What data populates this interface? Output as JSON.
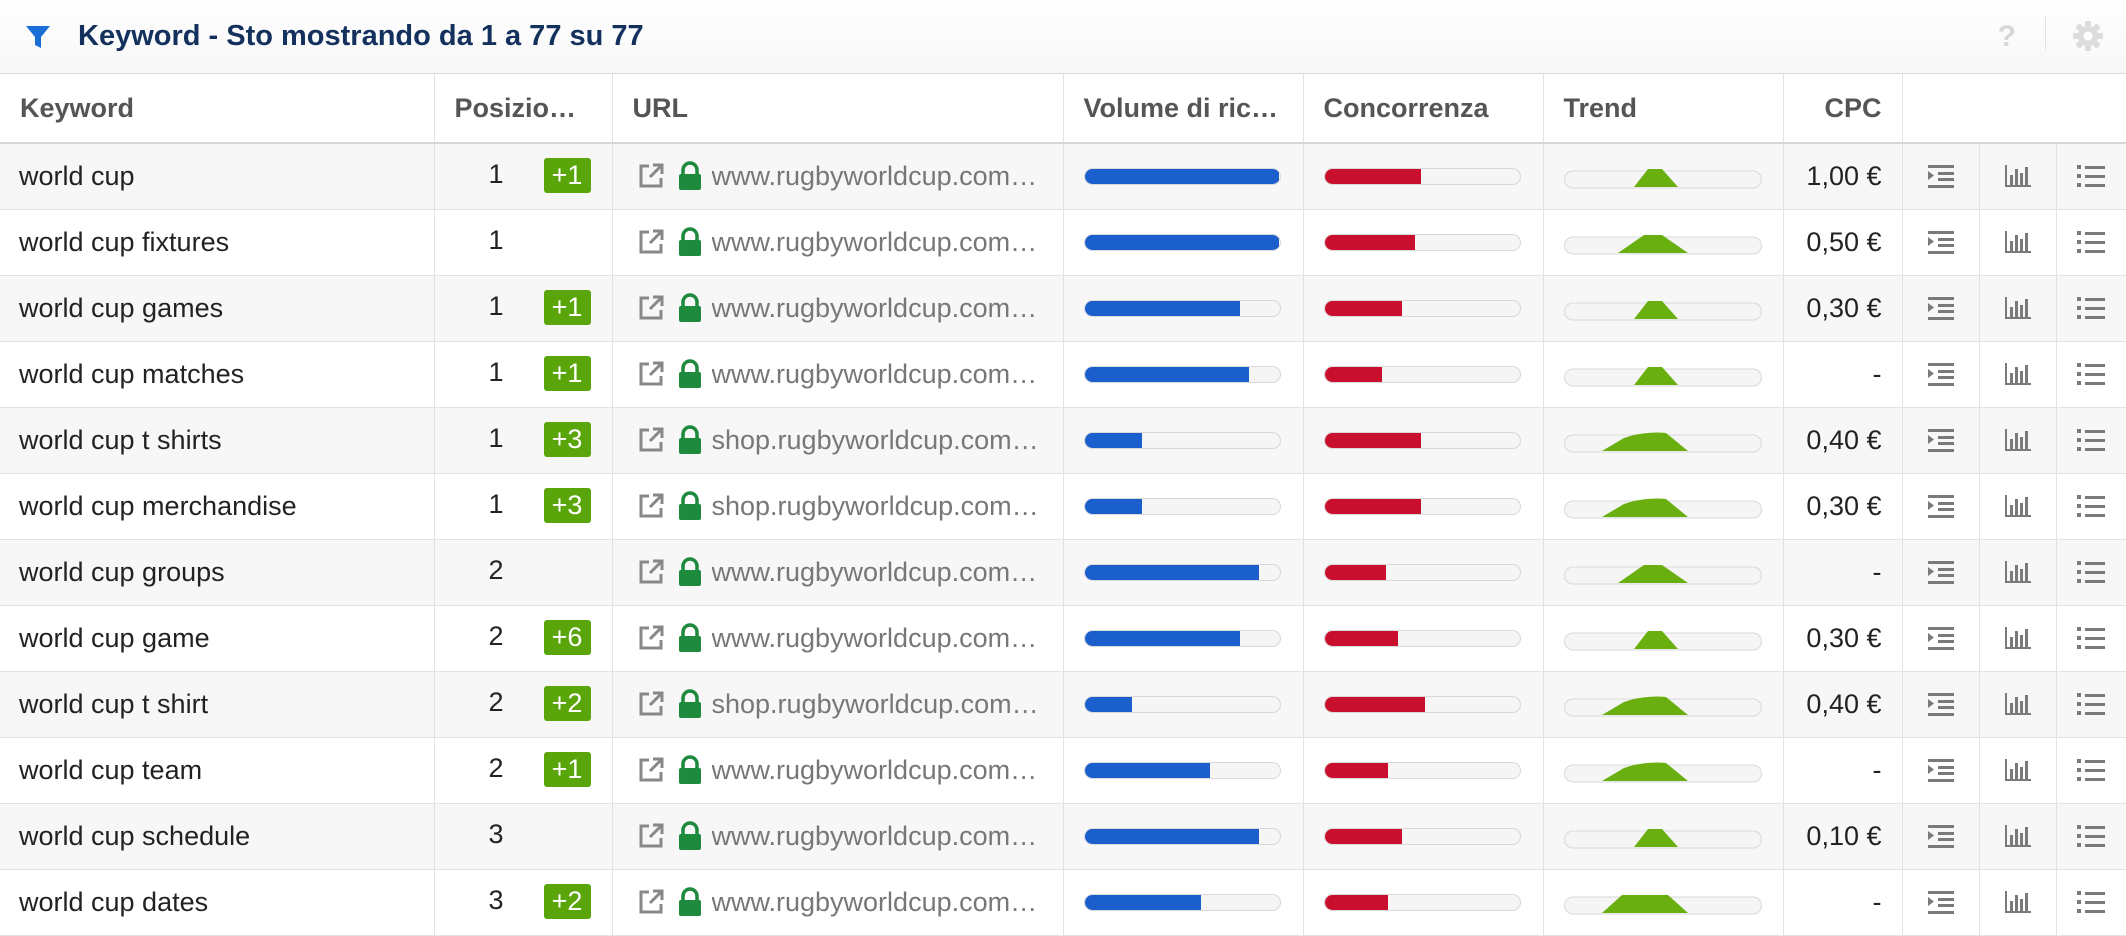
{
  "header": {
    "title": "Keyword - Sto mostrando da 1 a 77 su 77",
    "help_label": "?"
  },
  "columns": {
    "keyword": "Keyword",
    "position": "Posizion…",
    "url": "URL",
    "volume": "Volume di ric…",
    "competition": "Concorrenza",
    "trend": "Trend",
    "cpc": "CPC"
  },
  "colors": {
    "badge": "#5aa50a",
    "volume_bar": "#1a5fcc",
    "competition_bar": "#c8102e",
    "trend": "#6aaf10",
    "lock": "#1e8a3e",
    "title": "#13315c"
  },
  "rows": [
    {
      "keyword": "world cup",
      "position": "1",
      "change": "+1",
      "url": "www.rugbyworldcup.com…",
      "volume": 1.0,
      "competition": 0.5,
      "trend": "narrow",
      "cpc": "1,00 €"
    },
    {
      "keyword": "world cup fixtures",
      "position": "1",
      "change": "",
      "url": "www.rugbyworldcup.com…",
      "volume": 1.0,
      "competition": 0.47,
      "trend": "medium",
      "cpc": "0,50 €"
    },
    {
      "keyword": "world cup games",
      "position": "1",
      "change": "+1",
      "url": "www.rugbyworldcup.com…",
      "volume": 0.8,
      "competition": 0.4,
      "trend": "narrow",
      "cpc": "0,30 €"
    },
    {
      "keyword": "world cup matches",
      "position": "1",
      "change": "+1",
      "url": "www.rugbyworldcup.com…",
      "volume": 0.85,
      "competition": 0.3,
      "trend": "narrow",
      "cpc": "-"
    },
    {
      "keyword": "world cup t shirts",
      "position": "1",
      "change": "+3",
      "url": "shop.rugbyworldcup.com…",
      "volume": 0.3,
      "competition": 0.5,
      "trend": "wide",
      "cpc": "0,40 €"
    },
    {
      "keyword": "world cup merchandise",
      "position": "1",
      "change": "+3",
      "url": "shop.rugbyworldcup.com…",
      "volume": 0.3,
      "competition": 0.5,
      "trend": "wide",
      "cpc": "0,30 €"
    },
    {
      "keyword": "world cup groups",
      "position": "2",
      "change": "",
      "url": "www.rugbyworldcup.com…",
      "volume": 0.9,
      "competition": 0.32,
      "trend": "medium",
      "cpc": "-"
    },
    {
      "keyword": "world cup game",
      "position": "2",
      "change": "+6",
      "url": "www.rugbyworldcup.com…",
      "volume": 0.8,
      "competition": 0.38,
      "trend": "narrow",
      "cpc": "0,30 €"
    },
    {
      "keyword": "world cup t shirt",
      "position": "2",
      "change": "+2",
      "url": "shop.rugbyworldcup.com…",
      "volume": 0.25,
      "competition": 0.52,
      "trend": "wide",
      "cpc": "0,40 €"
    },
    {
      "keyword": "world cup team",
      "position": "2",
      "change": "+1",
      "url": "www.rugbyworldcup.com…",
      "volume": 0.65,
      "competition": 0.33,
      "trend": "wide",
      "cpc": "-"
    },
    {
      "keyword": "world cup schedule",
      "position": "3",
      "change": "",
      "url": "www.rugbyworldcup.com…",
      "volume": 0.9,
      "competition": 0.4,
      "trend": "narrow",
      "cpc": "0,10 €"
    },
    {
      "keyword": "world cup dates",
      "position": "3",
      "change": "+2",
      "url": "www.rugbyworldcup.com…",
      "volume": 0.6,
      "competition": 0.33,
      "trend": "flat",
      "cpc": "-"
    }
  ]
}
